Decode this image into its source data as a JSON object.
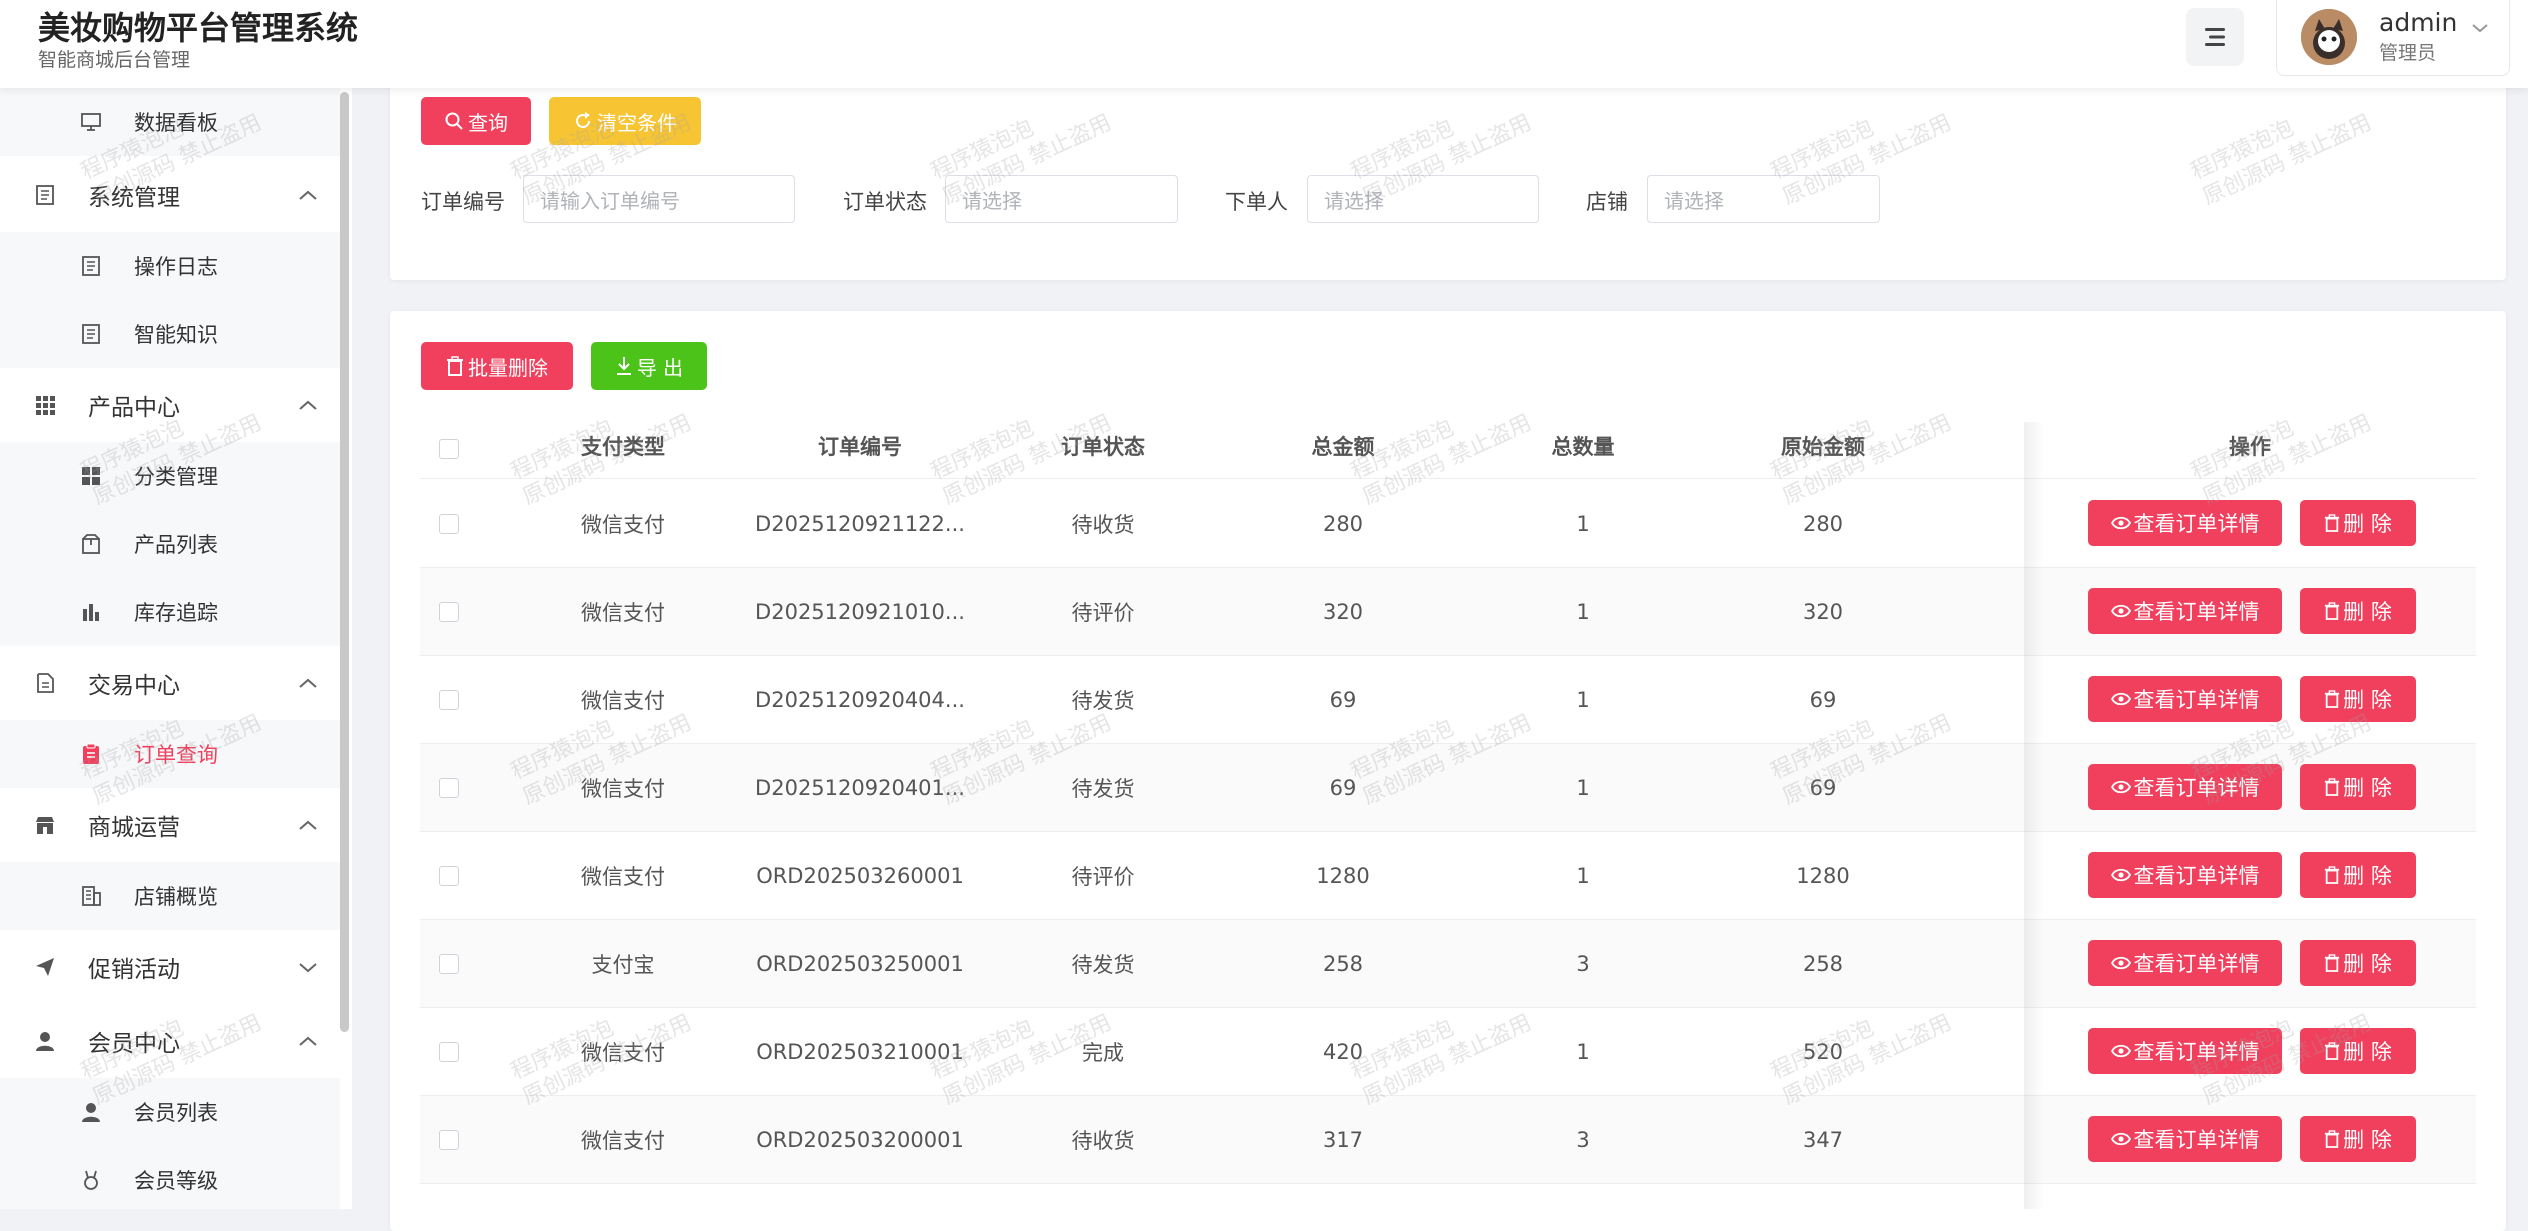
{
  "header": {
    "title": "美妆购物平台管理系统",
    "subtitle": "智能商城后台管理",
    "user_name": "admin",
    "user_role": "管理员"
  },
  "sidebar": {
    "items": [
      {
        "label": "数据看板",
        "icon": "monitor-icon",
        "level": "sub"
      },
      {
        "label": "系统管理",
        "icon": "document-icon",
        "level": "group",
        "expanded": true
      },
      {
        "label": "操作日志",
        "icon": "document-icon",
        "level": "sub"
      },
      {
        "label": "智能知识",
        "icon": "document-icon",
        "level": "sub"
      },
      {
        "label": "产品中心",
        "icon": "grid-icon",
        "level": "group",
        "expanded": true
      },
      {
        "label": "分类管理",
        "icon": "category-icon",
        "level": "sub"
      },
      {
        "label": "产品列表",
        "icon": "box-icon",
        "level": "sub"
      },
      {
        "label": "库存追踪",
        "icon": "bar-chart-icon",
        "level": "sub"
      },
      {
        "label": "交易中心",
        "icon": "file-icon",
        "level": "group",
        "expanded": true
      },
      {
        "label": "订单查询",
        "icon": "clipboard-icon",
        "level": "sub",
        "active": true
      },
      {
        "label": "商城运营",
        "icon": "store-icon",
        "level": "group",
        "expanded": true
      },
      {
        "label": "店铺概览",
        "icon": "building-icon",
        "level": "sub"
      },
      {
        "label": "促销活动",
        "icon": "send-icon",
        "level": "group",
        "expanded": false
      },
      {
        "label": "会员中心",
        "icon": "user-icon",
        "level": "group",
        "expanded": true
      },
      {
        "label": "会员列表",
        "icon": "user-icon",
        "level": "sub"
      },
      {
        "label": "会员等级",
        "icon": "medal-icon",
        "level": "sub"
      }
    ]
  },
  "search": {
    "query_label": "查询",
    "clear_label": "清空条件",
    "filters": [
      {
        "label": "订单编号",
        "placeholder": "请输入订单编号"
      },
      {
        "label": "订单状态",
        "placeholder": "请选择"
      },
      {
        "label": "下单人",
        "placeholder": "请选择"
      },
      {
        "label": "店铺",
        "placeholder": "请选择"
      }
    ]
  },
  "toolbar": {
    "batch_delete_label": "批量删除",
    "export_label": "导 出"
  },
  "table": {
    "columns": [
      "支付类型",
      "订单编号",
      "订单状态",
      "总金额",
      "总数量",
      "原始金额",
      "操作"
    ],
    "view_label": "查看订单详情",
    "delete_label": "删 除",
    "rows": [
      {
        "pay": "微信支付",
        "order_no": "D2025120921122...",
        "status": "待收货",
        "total": "280",
        "qty": "1",
        "original": "280"
      },
      {
        "pay": "微信支付",
        "order_no": "D2025120921010...",
        "status": "待评价",
        "total": "320",
        "qty": "1",
        "original": "320"
      },
      {
        "pay": "微信支付",
        "order_no": "D2025120920404...",
        "status": "待发货",
        "total": "69",
        "qty": "1",
        "original": "69"
      },
      {
        "pay": "微信支付",
        "order_no": "D2025120920401...",
        "status": "待发货",
        "total": "69",
        "qty": "1",
        "original": "69"
      },
      {
        "pay": "微信支付",
        "order_no": "ORD202503260001",
        "status": "待评价",
        "total": "1280",
        "qty": "1",
        "original": "1280"
      },
      {
        "pay": "支付宝",
        "order_no": "ORD202503250001",
        "status": "待发货",
        "total": "258",
        "qty": "3",
        "original": "258"
      },
      {
        "pay": "微信支付",
        "order_no": "ORD202503210001",
        "status": "完成",
        "total": "420",
        "qty": "1",
        "original": "520"
      },
      {
        "pay": "微信支付",
        "order_no": "ORD202503200001",
        "status": "待收货",
        "total": "317",
        "qty": "3",
        "original": "347"
      }
    ]
  },
  "watermark": {
    "line1": "程序猿泡泡",
    "line2": "原创源码 禁止盗用"
  },
  "colors": {
    "primary": "#f0405d",
    "warning": "#f7c534",
    "success": "#4cc319"
  }
}
